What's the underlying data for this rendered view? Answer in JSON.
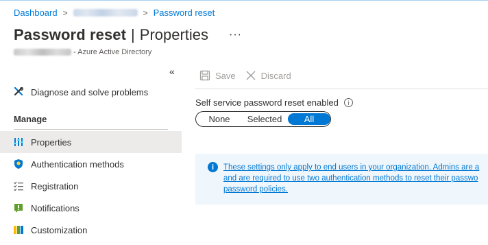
{
  "breadcrumb": {
    "items": [
      "Dashboard",
      "Password reset"
    ]
  },
  "header": {
    "title_main": "Password reset",
    "title_separator": "|",
    "title_sub": "Properties",
    "more_label": "···",
    "subtitle_suffix": "- Azure Active Directory"
  },
  "sidebar": {
    "collapse_label": "«",
    "diagnose_label": "Diagnose and solve problems",
    "manage_header": "Manage",
    "items": [
      {
        "label": "Properties",
        "icon": "properties-icon",
        "active": true
      },
      {
        "label": "Authentication methods",
        "icon": "shield-icon",
        "active": false
      },
      {
        "label": "Registration",
        "icon": "checklist-icon",
        "active": false
      },
      {
        "label": "Notifications",
        "icon": "notification-icon",
        "active": false
      },
      {
        "label": "Customization",
        "icon": "customization-icon",
        "active": false
      }
    ]
  },
  "toolbar": {
    "save_label": "Save",
    "discard_label": "Discard"
  },
  "setting": {
    "label": "Self service password reset enabled",
    "info_label": "i",
    "options": [
      "None",
      "Selected",
      "All"
    ],
    "selected": "All"
  },
  "banner": {
    "icon_label": "i",
    "lines": [
      "These settings only apply to end users in your organization. Admins are a",
      "and are required to use two authentication methods to reset their passwo",
      "password policies."
    ]
  },
  "colors": {
    "accent": "#0078d4",
    "banner_bg": "#eff6fc",
    "active_item_bg": "#edebe9"
  }
}
